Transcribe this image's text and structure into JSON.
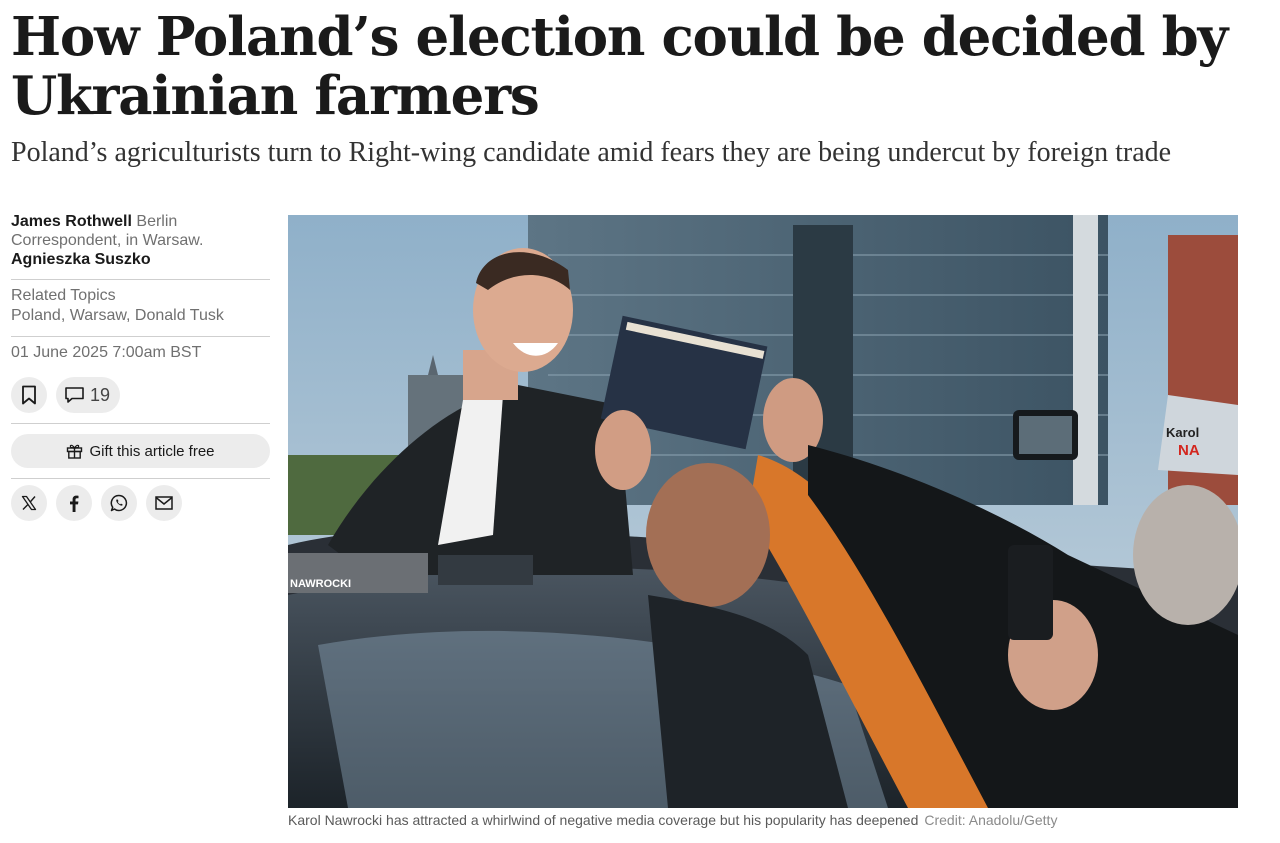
{
  "article": {
    "headline": "How Poland’s election could be decided by Ukrainian farmers",
    "standfirst": "Poland’s agriculturists turn to Right-wing candidate amid fears they are being undercut by foreign trade"
  },
  "byline": {
    "author1": "James Rothwell",
    "author1_role": "Berlin Correspondent, in Warsaw.",
    "author2": "Agnieszka Suszko"
  },
  "topics": {
    "label": "Related Topics",
    "list": "Poland, Warsaw, Donald Tusk"
  },
  "date": "01 June 2025 7:00am BST",
  "actions": {
    "comments_count": "19",
    "gift_label": "Gift this article free"
  },
  "icons": {
    "bookmark": "bookmark-icon",
    "comments": "speech-bubble-icon",
    "gift": "gift-icon",
    "share": [
      "x-icon",
      "facebook-icon",
      "whatsapp-icon",
      "email-icon"
    ]
  },
  "image": {
    "caption": "Karol Nawrocki has attracted a whirlwind of negative media coverage but his popularity has deepened",
    "credit": "Credit: Anadolu/Getty",
    "poster_text_1": "Karol",
    "poster_text_2": "NA",
    "poster_text_3": "NAWROCKI"
  },
  "colors": {
    "text": "#1a1a1a",
    "muted": "#707070",
    "button_bg": "#ececec",
    "divider": "#cfcfcf"
  }
}
